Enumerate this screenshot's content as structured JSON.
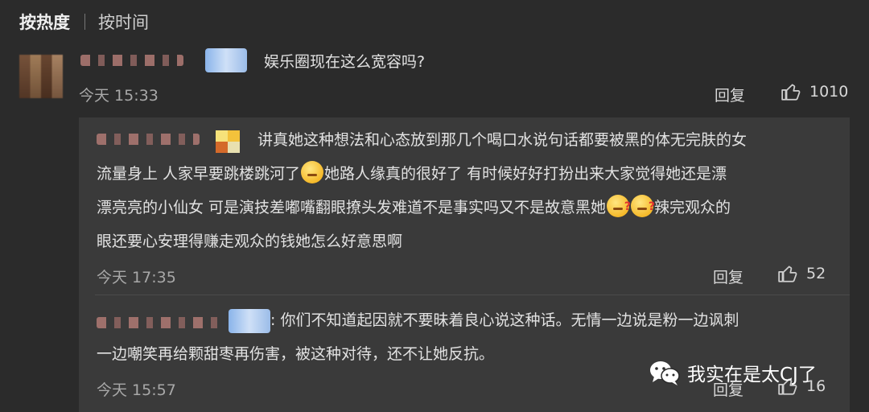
{
  "sort": {
    "hot": "按热度",
    "time": "按时间"
  },
  "comment": {
    "text": "娱乐圈现在这么宽容吗?",
    "time": "今天 15:33",
    "reply_label": "回复",
    "likes": "1010"
  },
  "replies": [
    {
      "lines": [
        "讲真她这种想法和心态放到那几个喝口水说句话都要被黑的体无完肤的女",
        "流量身上 人家早要跳楼跳河了",
        "她路人缘真的很好了 有时候好好打扮出来大家觉得她还是漂",
        "漂亮亮的小仙女 可是演技差嘟嘴翻眼撩头发难道不是事实吗又不是故意黑她",
        "辣完观众的",
        "眼还要心安理得赚走观众的钱她怎么好意思啊"
      ],
      "time": "今天 17:35",
      "reply_label": "回复",
      "likes": "52"
    },
    {
      "lines": [
        ": 你们不知道起因就不要昧着良心说这种话。无情一边说是粉一边讽刺",
        "一边嘲笑再给颗甜枣再伤害，被这种对待，还不让她反抗。"
      ],
      "time": "今天 15:57",
      "reply_label": "回复",
      "likes": "16"
    }
  ],
  "watermark": {
    "text": "我实在是太CJ了",
    "icon": "wechat-icon"
  },
  "colors": {
    "background": "#2b2b2b",
    "panel": "#3a3a3a"
  }
}
